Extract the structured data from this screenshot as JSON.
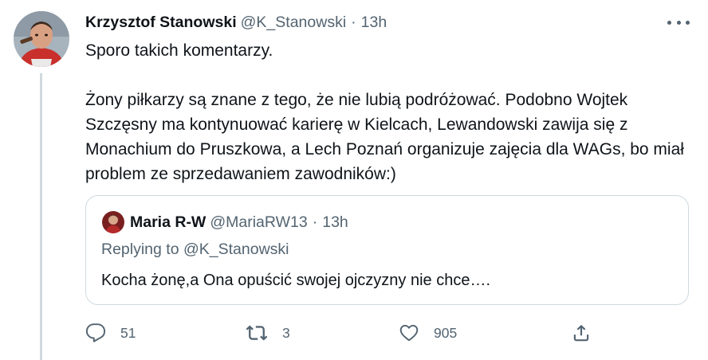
{
  "tweet": {
    "author": {
      "display_name": "Krzysztof Stanowski",
      "handle": "@K_Stanowski",
      "separator": "·",
      "time": "13h",
      "avatar_icon": "profile-photo"
    },
    "text": {
      "line1": "Sporo takich komentarzy.",
      "paragraph2": "Żony piłkarzy są znane z tego, że nie lubią podróżować. Podobno Wojtek Szczęsny ma kontynuować karierę w Kielcach, Lewandowski zawija się z Monachium do Pruszkowa, a Lech Poznań organizuje zajęcia dla WAGs, bo miał problem ze sprzedawaniem zawodników:)"
    },
    "quote": {
      "display_name": "Maria R-W",
      "handle": "@MariaRW13",
      "separator": "·",
      "time": "13h",
      "replying_prefix": "Replying to",
      "replying_to": "@K_Stanowski",
      "text": "Kocha żonę,a Ona opuścić swojej ojczyzny nie chce…."
    },
    "actions": {
      "replies": "51",
      "retweets": "3",
      "likes": "905"
    }
  },
  "colors": {
    "primary_text": "#0f1419",
    "secondary_text": "#536471",
    "border": "#cfd9de"
  }
}
